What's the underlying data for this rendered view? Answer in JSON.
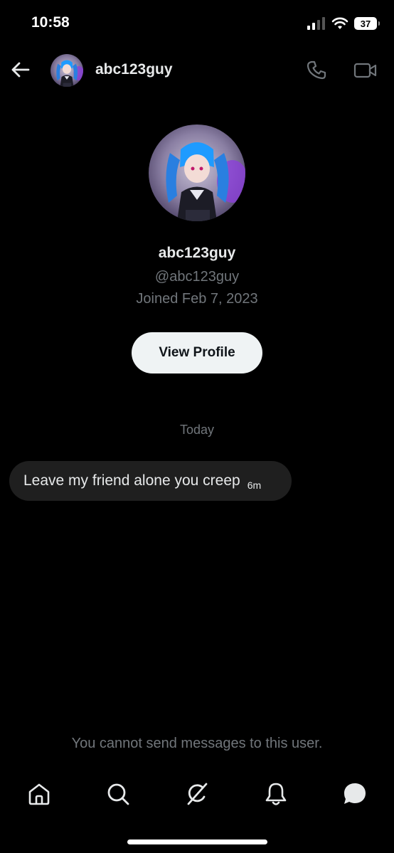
{
  "status_bar": {
    "time": "10:58",
    "battery": "37"
  },
  "header": {
    "username": "abc123guy"
  },
  "profile": {
    "display_name": "abc123guy",
    "handle": "@abc123guy",
    "joined": "Joined Feb 7, 2023",
    "view_profile_label": "View Profile"
  },
  "conversation": {
    "date_separator": "Today",
    "messages": [
      {
        "text": "Leave my friend alone you creep",
        "time": "6m"
      }
    ],
    "blocked_notice": "You cannot send messages to this user."
  },
  "nav": {
    "items": [
      "home-icon",
      "search-icon",
      "grok-icon",
      "notifications-icon",
      "messages-icon"
    ]
  },
  "colors": {
    "background": "#000000",
    "primary_text": "#e7e9ea",
    "secondary_text": "#71767b",
    "bubble": "#1f1f1f",
    "button_bg": "#eff3f4"
  }
}
